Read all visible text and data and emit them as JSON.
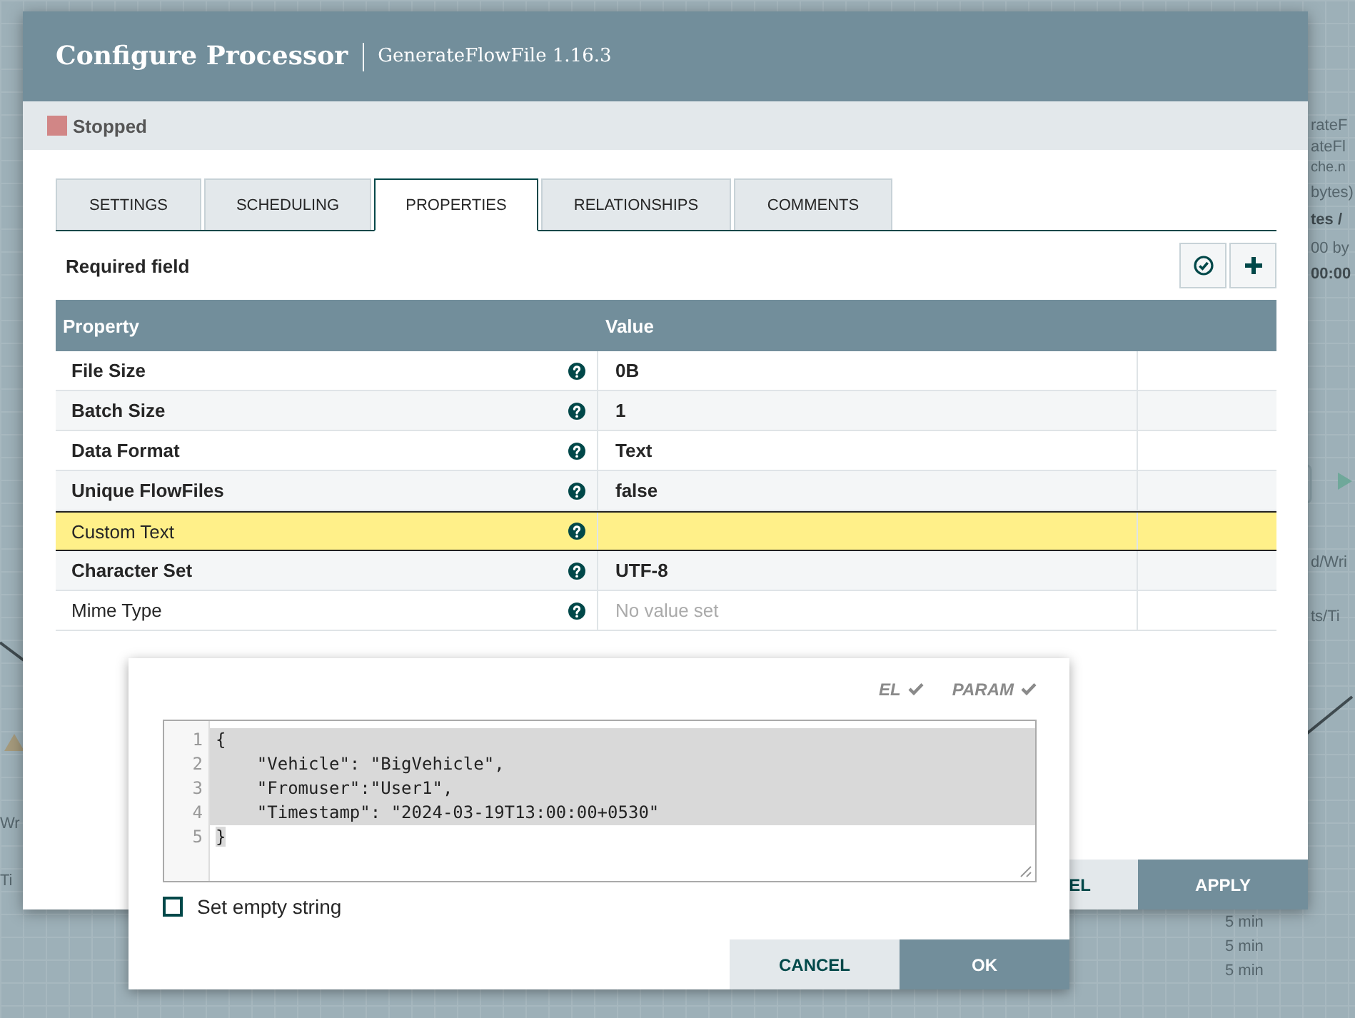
{
  "canvas": {
    "fragments": [
      {
        "text": "rateF",
        "bold": false
      },
      {
        "text": "ateFl",
        "bold": false
      },
      {
        "text": "che.n",
        "bold": false
      },
      {
        "text": "bytes)",
        "bold": false
      },
      {
        "text": "tes /",
        "bold": true
      },
      {
        "text": "00 by",
        "bold": false
      },
      {
        "text": "00:00",
        "bold": true
      },
      {
        "text": "d/Wri",
        "bold": false
      },
      {
        "text": "ts/Ti",
        "bold": false
      },
      {
        "text": "Wr",
        "bold": false
      },
      {
        "text": "Ti",
        "bold": false
      },
      {
        "text": "5 min",
        "bold": false
      },
      {
        "text": "5 min",
        "bold": false
      },
      {
        "text": "5 min",
        "bold": false
      }
    ]
  },
  "dialog": {
    "title": "Configure Processor",
    "subtitle": "GenerateFlowFile 1.16.3",
    "status": {
      "label": "Stopped",
      "color": "#d18686"
    },
    "tabs": [
      {
        "label": "SETTINGS",
        "selected": false
      },
      {
        "label": "SCHEDULING",
        "selected": false
      },
      {
        "label": "PROPERTIES",
        "selected": true
      },
      {
        "label": "RELATIONSHIPS",
        "selected": false
      },
      {
        "label": "COMMENTS",
        "selected": false
      }
    ],
    "required_label": "Required field",
    "table": {
      "columns": [
        "Property",
        "Value"
      ],
      "rows": [
        {
          "name": "File Size",
          "required": true,
          "value": "0B",
          "selected": false
        },
        {
          "name": "Batch Size",
          "required": true,
          "value": "1",
          "selected": false
        },
        {
          "name": "Data Format",
          "required": true,
          "value": "Text",
          "selected": false
        },
        {
          "name": "Unique FlowFiles",
          "required": true,
          "value": "false",
          "selected": false
        },
        {
          "name": "Custom Text",
          "required": false,
          "value": "",
          "selected": true
        },
        {
          "name": "Character Set",
          "required": true,
          "value": "UTF-8",
          "selected": false
        },
        {
          "name": "Mime Type",
          "required": false,
          "placeholder": "No value set",
          "selected": false
        }
      ]
    },
    "buttons": [
      {
        "label": "EL",
        "kind": "secondary"
      },
      {
        "label": "APPLY",
        "kind": "primary"
      }
    ]
  },
  "editor": {
    "flags": [
      {
        "label": "EL",
        "checked": true
      },
      {
        "label": "PARAM",
        "checked": true
      }
    ],
    "lines": [
      "{",
      "    \"Vehicle\": \"BigVehicle\",",
      "    \"Fromuser\":\"User1\",",
      "    \"Timestamp\": \"2024-03-19T13:00:00+0530\"",
      "}"
    ],
    "line_numbers": [
      "1",
      "2",
      "3",
      "4",
      "5"
    ],
    "set_empty_string": {
      "label": "Set empty string",
      "checked": false
    },
    "buttons": [
      {
        "label": "CANCEL",
        "kind": "secondary"
      },
      {
        "label": "OK",
        "kind": "primary"
      }
    ]
  }
}
